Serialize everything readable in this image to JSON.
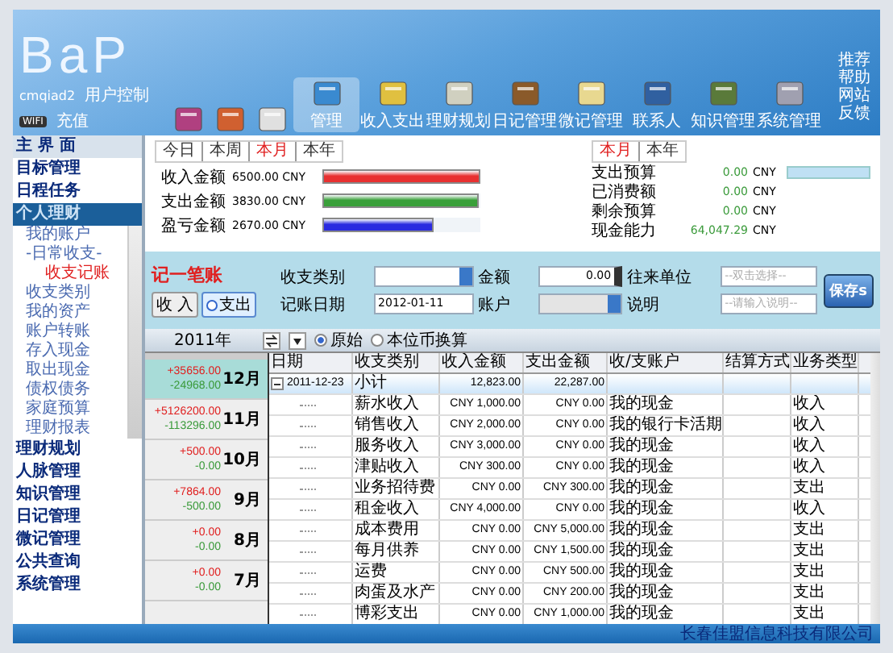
{
  "header": {
    "logo": "BaP",
    "user": "cmqiad2",
    "user_menu": "用户控制",
    "badge": "WIFI",
    "recharge": "充值",
    "nav": [
      {
        "selected": false
      },
      {
        "selected": false
      },
      {
        "selected": false
      },
      {
        "label": "管理",
        "selected": true
      },
      {
        "label": "收入支出",
        "selected": false
      },
      {
        "label": "理财规划",
        "selected": false
      },
      {
        "label": "日记管理",
        "selected": false
      },
      {
        "label": "微记管理",
        "selected": false
      },
      {
        "label": "联系人",
        "selected": false
      },
      {
        "label": "知识管理",
        "selected": false
      },
      {
        "label": "系统管理",
        "selected": false
      }
    ],
    "links": [
      "推荐",
      "帮助",
      "网站",
      "反馈"
    ]
  },
  "sidebar": {
    "top": [
      {
        "label": "主 界 面",
        "selected": false
      },
      {
        "label": "目标管理",
        "selected": false
      },
      {
        "label": "日程任务",
        "selected": false
      },
      {
        "label": "个人理财",
        "selected": true
      }
    ],
    "sub": [
      {
        "label": "我的账户",
        "selected": false
      },
      {
        "label": "-日常收支-",
        "selected": false
      },
      {
        "label": "收支记账",
        "selected": true
      },
      {
        "label": "收支类别",
        "selected": false
      },
      {
        "label": "我的资产",
        "selected": false
      },
      {
        "label": "账户转账",
        "selected": false
      },
      {
        "label": "存入现金",
        "selected": false
      },
      {
        "label": "取出现金",
        "selected": false
      },
      {
        "label": "债权债务",
        "selected": false
      },
      {
        "label": "家庭预算",
        "selected": false
      },
      {
        "label": "理财报表",
        "selected": false
      }
    ],
    "bottom": [
      "理财规划",
      "人脉管理",
      "知识管理",
      "日记管理",
      "微记管理",
      "公共查询",
      "系统管理"
    ]
  },
  "summary": {
    "periods": [
      {
        "label": "今日",
        "selected": false
      },
      {
        "label": "本周",
        "selected": false
      },
      {
        "label": "本月",
        "selected": true
      },
      {
        "label": "本年",
        "selected": false
      }
    ],
    "bars": [
      {
        "label": "收入金额",
        "amount": "6500.00 CNY",
        "color": "#e83030",
        "level": 1.0
      },
      {
        "label": "支出金额",
        "amount": "3830.00 CNY",
        "color": "#3aa03a",
        "level": 0.99
      },
      {
        "label": "盈亏金额",
        "amount": "2670.00 CNY",
        "color": "#2a2ae0",
        "level": 0.7
      }
    ]
  },
  "budget": {
    "periods": [
      {
        "label": "本月",
        "selected": true
      },
      {
        "label": "本年",
        "selected": false
      }
    ],
    "rows": [
      {
        "label": "支出预算",
        "value": "0.00",
        "unit": "CNY"
      },
      {
        "label": "已消费额",
        "value": "0.00",
        "unit": "CNY"
      },
      {
        "label": "剩余预算",
        "value": "0.00",
        "unit": "CNY"
      },
      {
        "label": "现金能力",
        "value": "64,047.29",
        "unit": "CNY"
      }
    ]
  },
  "form": {
    "title": "记一笔账",
    "types": [
      {
        "label": "收 入",
        "selected": false
      },
      {
        "label": "支出",
        "selected": true
      }
    ],
    "category_label": "收支类别",
    "amount_label": "金额",
    "amount": "0.00",
    "party_label": "往来单位",
    "party_placeholder": "--双击选择--",
    "date_label": "记账日期",
    "date": "2012-01-11",
    "account_label": "账户",
    "note_label": "说明",
    "note_placeholder": "--请输入说明--",
    "save": "保存s"
  },
  "filter": {
    "year": "2011年",
    "modes": [
      {
        "label": "原始",
        "selected": true
      },
      {
        "label": "本位币换算",
        "selected": false
      }
    ]
  },
  "months": [
    {
      "month": "12月",
      "income": "+35656.00",
      "expense": "-24968.00",
      "selected": true
    },
    {
      "month": "11月",
      "income": "+5126200.00",
      "expense": "-113296.00",
      "selected": false
    },
    {
      "month": "10月",
      "income": "+500.00",
      "expense": "-0.00",
      "selected": false
    },
    {
      "month": "9月",
      "income": "+7864.00",
      "expense": "-500.00",
      "selected": false
    },
    {
      "month": "8月",
      "income": "+0.00",
      "expense": "-0.00",
      "selected": false
    },
    {
      "month": "7月",
      "income": "+0.00",
      "expense": "-0.00",
      "selected": false
    }
  ],
  "table": {
    "columns": [
      "日期",
      "收支类别",
      "收入金额",
      "支出金额",
      "收/支账户",
      "结算方式",
      "业务类型"
    ],
    "group": {
      "date": "2011-12-23",
      "label": "小计",
      "income": "12,823.00",
      "expense": "22,287.00",
      "expanded": true
    },
    "rows": [
      [
        "",
        "薪水收入",
        "CNY 1,000.00",
        "CNY 0.00",
        "我的现金",
        "",
        "收入"
      ],
      [
        "",
        "销售收入",
        "CNY 2,000.00",
        "CNY 0.00",
        "我的银行卡活期",
        "",
        "收入"
      ],
      [
        "",
        "服务收入",
        "CNY 3,000.00",
        "CNY 0.00",
        "我的现金",
        "",
        "收入"
      ],
      [
        "",
        "津贴收入",
        "CNY 300.00",
        "CNY 0.00",
        "我的现金",
        "",
        "收入"
      ],
      [
        "",
        "业务招待费",
        "CNY 0.00",
        "CNY 300.00",
        "我的现金",
        "",
        "支出"
      ],
      [
        "",
        "租金收入",
        "CNY 4,000.00",
        "CNY 0.00",
        "我的现金",
        "",
        "收入"
      ],
      [
        "",
        "成本费用",
        "CNY 0.00",
        "CNY 5,000.00",
        "我的现金",
        "",
        "支出"
      ],
      [
        "",
        "每月供养",
        "CNY 0.00",
        "CNY 1,500.00",
        "我的现金",
        "",
        "支出"
      ],
      [
        "",
        "运费",
        "CNY 0.00",
        "CNY 500.00",
        "我的现金",
        "",
        "支出"
      ],
      [
        "",
        "肉蛋及水产",
        "CNY 0.00",
        "CNY 200.00",
        "我的现金",
        "",
        "支出"
      ],
      [
        "",
        "博彩支出",
        "CNY 0.00",
        "CNY 1,000.00",
        "我的现金",
        "",
        "支出"
      ]
    ]
  },
  "footer": "长春佳盟信息科技有限公司"
}
